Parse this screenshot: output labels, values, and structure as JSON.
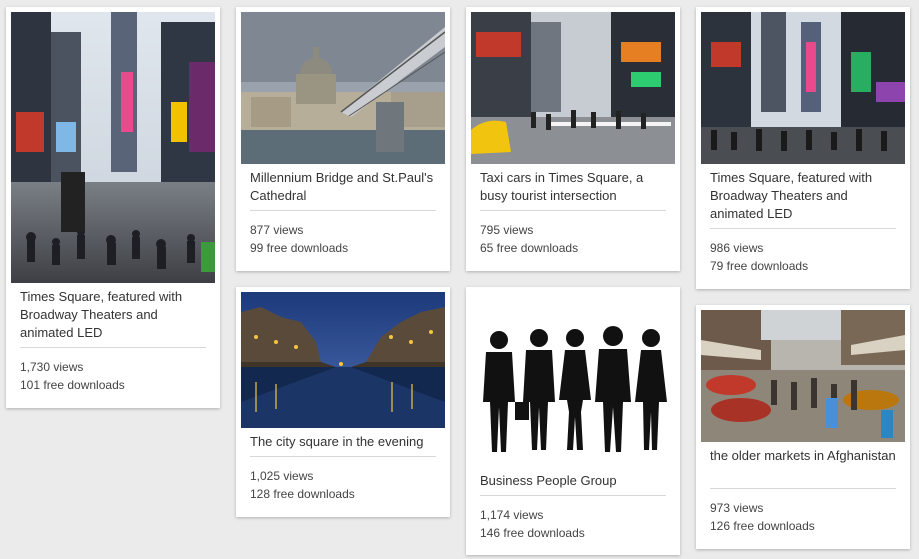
{
  "cards": [
    {
      "title": "Times Square, featured with Broadway Theaters and animated LED",
      "views": "1,730 views",
      "downloads": "101 free downloads",
      "image": "times-square-night-crowd-photo"
    },
    {
      "title": "Millennium Bridge and St.Paul's Cathedral",
      "views": "877 views",
      "downloads": "99 free downloads",
      "image": "millennium-bridge-photo"
    },
    {
      "title": "Taxi cars in Times Square, a busy tourist intersection",
      "views": "795 views",
      "downloads": "65 free downloads",
      "image": "times-square-taxi-photo"
    },
    {
      "title": "Times Square, featured with Broadway Theaters and animated LED",
      "views": "986 views",
      "downloads": "79 free downloads",
      "image": "times-square-crowd-photo"
    },
    {
      "title": "The city square in the evening",
      "views": "1,025 views",
      "downloads": "128 free downloads",
      "image": "canal-evening-photo"
    },
    {
      "title": "Business People Group",
      "views": "1,174 views",
      "downloads": "146 free downloads",
      "image": "business-silhouettes-image"
    },
    {
      "title": "the older markets in Afghanistan",
      "views": "973 views",
      "downloads": "126 free downloads",
      "image": "afghan-market-photo"
    }
  ],
  "colors": {
    "background": "#ebebeb",
    "card": "#ffffff",
    "text": "#333333",
    "divider": "#d8d8d8"
  }
}
